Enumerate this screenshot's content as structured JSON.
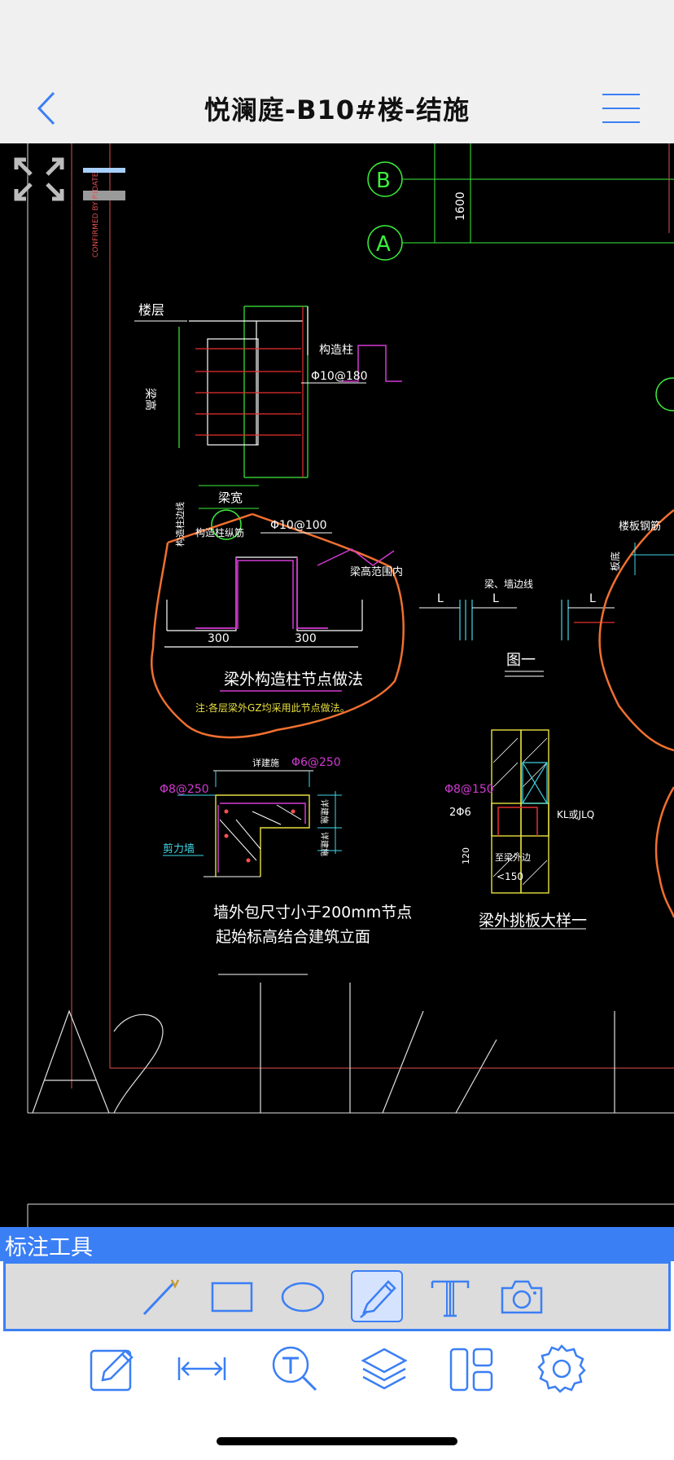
{
  "header": {
    "title": "悦澜庭-B10#楼-结施"
  },
  "drawing": {
    "axis_labels": [
      "B",
      "A"
    ],
    "dim_vertical": "1600",
    "confirmed_by": "CONFIRMED BY P.IDATE",
    "floor_label": "楼层",
    "beam_height_label": "梁高",
    "construction_column": "构造柱",
    "rebar_spec_1": "Φ10@180",
    "beam_width_label": "梁宽",
    "rebar_spec_2": "Φ10@100",
    "column_side_label": "构造柱边线",
    "column_rebar_label": "构造柱纵筋",
    "beam_inner_label": "梁高范围内",
    "dim_300_left": "300",
    "dim_300_right": "300",
    "node_title": "梁外构造柱节点做法",
    "node_note": "注:各层梁外GZ均采用此节点做法。",
    "beam_axis_label": "梁、墙边线",
    "dim_L1": "L",
    "dim_L2": "L",
    "dim_L3": "L",
    "fig_label": "图一",
    "slab_label": "楼板钢筋",
    "slab_side": "板底",
    "rebar_top": "Φ6@250",
    "rebar_left": "Φ8@250",
    "detail_top": "详建施",
    "shear_wall": "剪力墙",
    "dim_side_a": "详建施",
    "dim_side_b": "详建施",
    "caption_1": "墙外包尺寸小于200mm节点",
    "caption_2": "起始标高结合建筑立面",
    "rebar_150": "Φ8@150",
    "rebar_2phi6": "2Φ6",
    "dim_120": "120",
    "kl_label": "KL或JLQ",
    "outer_wall": "至梁外边",
    "dim_150": "<150",
    "caption_3": "梁外挑板大样一"
  },
  "annotation_tools": {
    "title": "标注工具",
    "tools": [
      "line-tool",
      "rectangle-tool",
      "ellipse-tool",
      "pen-tool",
      "text-tool",
      "camera-tool"
    ],
    "active_tool": "pen-tool"
  },
  "bottom_toolbar": {
    "tools": [
      "edit-icon",
      "measure-icon",
      "text-search-icon",
      "layers-icon",
      "layout-icon",
      "settings-icon"
    ]
  },
  "colors": {
    "accent": "#3b7ff5",
    "canvas": "#000000",
    "cad_green": "#3cf03c",
    "cad_magenta": "#d23ad2",
    "cad_red": "#e83030",
    "cad_orange": "#f07030",
    "cad_yellow": "#e8e040",
    "cad_cyan": "#40d8e8"
  }
}
